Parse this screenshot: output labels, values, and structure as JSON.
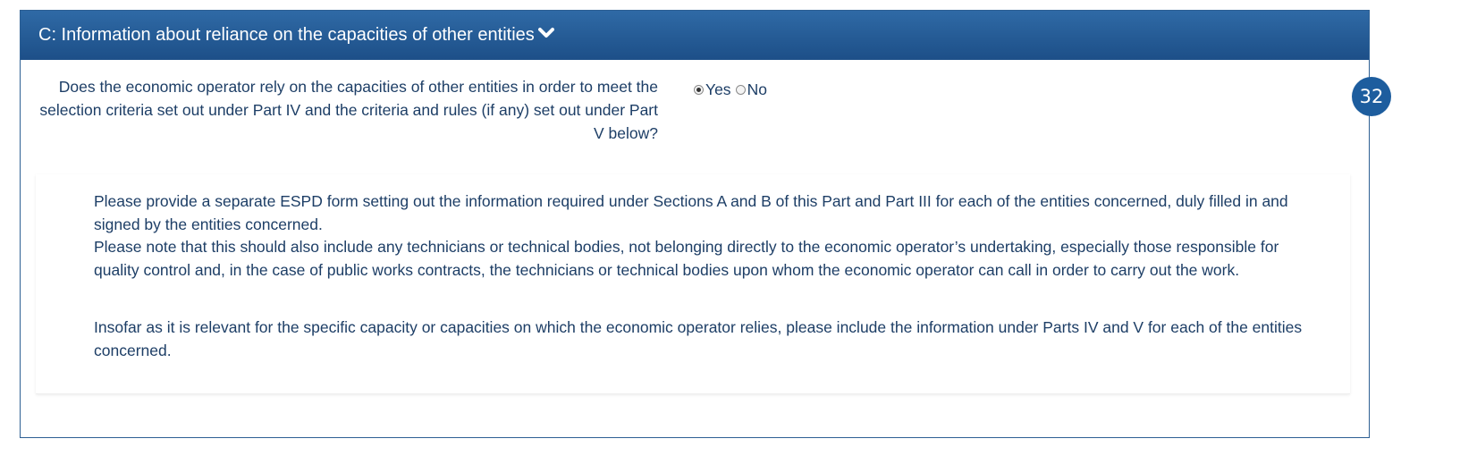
{
  "section": {
    "title": "C: Information about reliance on the capacities of other entities",
    "question": "Does the economic operator rely on the capacities of other entities in order to meet the selection criteria set out under Part IV and the criteria and rules (if any) set out under Part V below?",
    "options": [
      {
        "label": "Yes",
        "selected": true
      },
      {
        "label": "No",
        "selected": false
      }
    ],
    "info": {
      "paragraph1": "Please provide a separate ESPD form setting out the information required under Sections A and B of this Part and Part III for each of the entities concerned, duly filled in and signed by the entities concerned.",
      "paragraph2": "Please note that this should also include any technicians or technical bodies, not belonging directly to the economic operator’s undertaking, especially those responsible for quality control and, in the case of public works contracts, the technicians or technical bodies upon whom the economic operator can call in order to carry out the work.",
      "paragraph3": "Insofar as it is relevant for the specific capacity or capacities on which the economic operator relies, please include the information under Parts IV and V for each of the entities concerned."
    }
  },
  "badge": {
    "number": "32"
  },
  "icons": {
    "toggle": "chevron-down-icon"
  },
  "colors": {
    "header": "#255b95",
    "text": "#1d3e66",
    "badge": "#1d5d9e"
  }
}
